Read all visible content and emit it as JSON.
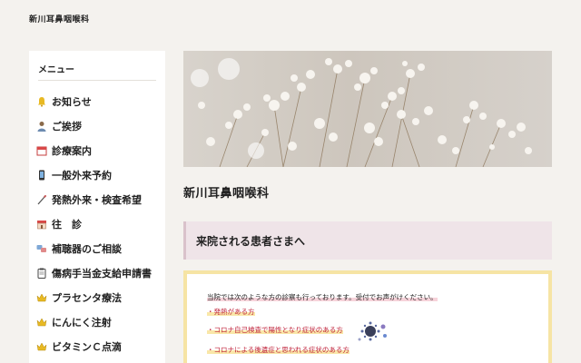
{
  "header": {
    "site_title": "新川耳鼻咽喉科"
  },
  "sidebar": {
    "heading": "メニュー",
    "items": [
      {
        "label": "お知らせ",
        "icon": "bell-icon"
      },
      {
        "label": "ご挨拶",
        "icon": "doctor-icon"
      },
      {
        "label": "診療案内",
        "icon": "calendar-icon"
      },
      {
        "label": "一般外来予約",
        "icon": "phone-icon"
      },
      {
        "label": "発熱外来・検査希望",
        "icon": "swab-icon"
      },
      {
        "label": "往　診",
        "icon": "house-icon"
      },
      {
        "label": "補聴器のご相談",
        "icon": "hearing-aid-icon"
      },
      {
        "label": "傷病手当金支給申請書",
        "icon": "clipboard-icon"
      },
      {
        "label": "プラセンタ療法",
        "icon": "crown-icon"
      },
      {
        "label": "にんにく注射",
        "icon": "crown-icon"
      },
      {
        "label": "ビタミンＣ点滴",
        "icon": "crown-icon"
      }
    ]
  },
  "main": {
    "clinic_title": "新川耳鼻咽喉科",
    "notice_heading": "来院される患者さまへ",
    "info": {
      "intro": "当院では次のような方の診察も行っております。受付でお声がけください。",
      "items": [
        "・発熱がある方",
        "・コロナ自己検査で陽性となり症状のある方",
        "・コロナによる後遺症と思われる症状のある方"
      ]
    }
  },
  "colors": {
    "background": "#f4f2ee",
    "notice_bar": "#efe4e8",
    "info_border": "#f6e4a4",
    "accent_red": "#c0243b"
  }
}
